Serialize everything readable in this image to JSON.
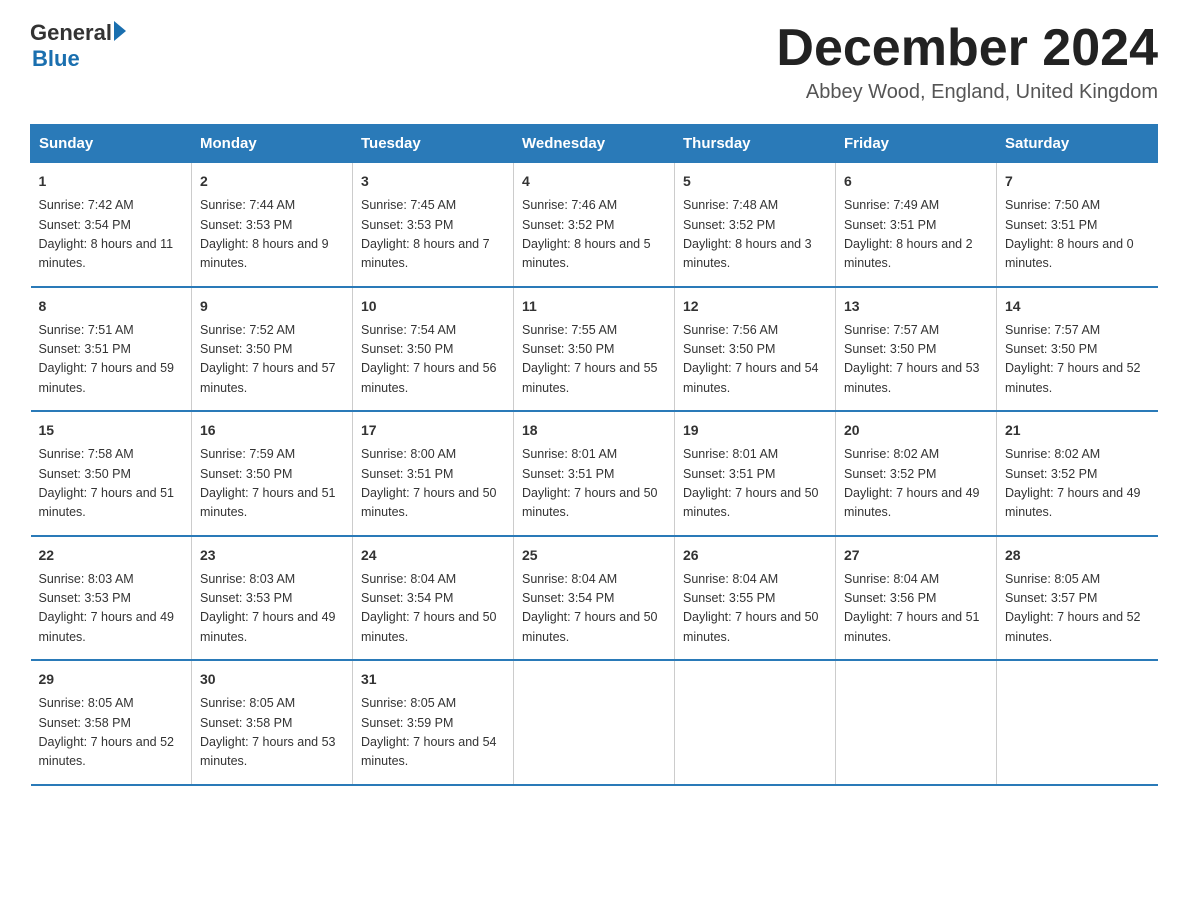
{
  "logo": {
    "general": "General",
    "arrow": "▶",
    "blue": "Blue"
  },
  "title": "December 2024",
  "location": "Abbey Wood, England, United Kingdom",
  "days_of_week": [
    "Sunday",
    "Monday",
    "Tuesday",
    "Wednesday",
    "Thursday",
    "Friday",
    "Saturday"
  ],
  "weeks": [
    [
      {
        "day": "1",
        "sunrise": "7:42 AM",
        "sunset": "3:54 PM",
        "daylight": "8 hours and 11 minutes."
      },
      {
        "day": "2",
        "sunrise": "7:44 AM",
        "sunset": "3:53 PM",
        "daylight": "8 hours and 9 minutes."
      },
      {
        "day": "3",
        "sunrise": "7:45 AM",
        "sunset": "3:53 PM",
        "daylight": "8 hours and 7 minutes."
      },
      {
        "day": "4",
        "sunrise": "7:46 AM",
        "sunset": "3:52 PM",
        "daylight": "8 hours and 5 minutes."
      },
      {
        "day": "5",
        "sunrise": "7:48 AM",
        "sunset": "3:52 PM",
        "daylight": "8 hours and 3 minutes."
      },
      {
        "day": "6",
        "sunrise": "7:49 AM",
        "sunset": "3:51 PM",
        "daylight": "8 hours and 2 minutes."
      },
      {
        "day": "7",
        "sunrise": "7:50 AM",
        "sunset": "3:51 PM",
        "daylight": "8 hours and 0 minutes."
      }
    ],
    [
      {
        "day": "8",
        "sunrise": "7:51 AM",
        "sunset": "3:51 PM",
        "daylight": "7 hours and 59 minutes."
      },
      {
        "day": "9",
        "sunrise": "7:52 AM",
        "sunset": "3:50 PM",
        "daylight": "7 hours and 57 minutes."
      },
      {
        "day": "10",
        "sunrise": "7:54 AM",
        "sunset": "3:50 PM",
        "daylight": "7 hours and 56 minutes."
      },
      {
        "day": "11",
        "sunrise": "7:55 AM",
        "sunset": "3:50 PM",
        "daylight": "7 hours and 55 minutes."
      },
      {
        "day": "12",
        "sunrise": "7:56 AM",
        "sunset": "3:50 PM",
        "daylight": "7 hours and 54 minutes."
      },
      {
        "day": "13",
        "sunrise": "7:57 AM",
        "sunset": "3:50 PM",
        "daylight": "7 hours and 53 minutes."
      },
      {
        "day": "14",
        "sunrise": "7:57 AM",
        "sunset": "3:50 PM",
        "daylight": "7 hours and 52 minutes."
      }
    ],
    [
      {
        "day": "15",
        "sunrise": "7:58 AM",
        "sunset": "3:50 PM",
        "daylight": "7 hours and 51 minutes."
      },
      {
        "day": "16",
        "sunrise": "7:59 AM",
        "sunset": "3:50 PM",
        "daylight": "7 hours and 51 minutes."
      },
      {
        "day": "17",
        "sunrise": "8:00 AM",
        "sunset": "3:51 PM",
        "daylight": "7 hours and 50 minutes."
      },
      {
        "day": "18",
        "sunrise": "8:01 AM",
        "sunset": "3:51 PM",
        "daylight": "7 hours and 50 minutes."
      },
      {
        "day": "19",
        "sunrise": "8:01 AM",
        "sunset": "3:51 PM",
        "daylight": "7 hours and 50 minutes."
      },
      {
        "day": "20",
        "sunrise": "8:02 AM",
        "sunset": "3:52 PM",
        "daylight": "7 hours and 49 minutes."
      },
      {
        "day": "21",
        "sunrise": "8:02 AM",
        "sunset": "3:52 PM",
        "daylight": "7 hours and 49 minutes."
      }
    ],
    [
      {
        "day": "22",
        "sunrise": "8:03 AM",
        "sunset": "3:53 PM",
        "daylight": "7 hours and 49 minutes."
      },
      {
        "day": "23",
        "sunrise": "8:03 AM",
        "sunset": "3:53 PM",
        "daylight": "7 hours and 49 minutes."
      },
      {
        "day": "24",
        "sunrise": "8:04 AM",
        "sunset": "3:54 PM",
        "daylight": "7 hours and 50 minutes."
      },
      {
        "day": "25",
        "sunrise": "8:04 AM",
        "sunset": "3:54 PM",
        "daylight": "7 hours and 50 minutes."
      },
      {
        "day": "26",
        "sunrise": "8:04 AM",
        "sunset": "3:55 PM",
        "daylight": "7 hours and 50 minutes."
      },
      {
        "day": "27",
        "sunrise": "8:04 AM",
        "sunset": "3:56 PM",
        "daylight": "7 hours and 51 minutes."
      },
      {
        "day": "28",
        "sunrise": "8:05 AM",
        "sunset": "3:57 PM",
        "daylight": "7 hours and 52 minutes."
      }
    ],
    [
      {
        "day": "29",
        "sunrise": "8:05 AM",
        "sunset": "3:58 PM",
        "daylight": "7 hours and 52 minutes."
      },
      {
        "day": "30",
        "sunrise": "8:05 AM",
        "sunset": "3:58 PM",
        "daylight": "7 hours and 53 minutes."
      },
      {
        "day": "31",
        "sunrise": "8:05 AM",
        "sunset": "3:59 PM",
        "daylight": "7 hours and 54 minutes."
      },
      null,
      null,
      null,
      null
    ]
  ]
}
